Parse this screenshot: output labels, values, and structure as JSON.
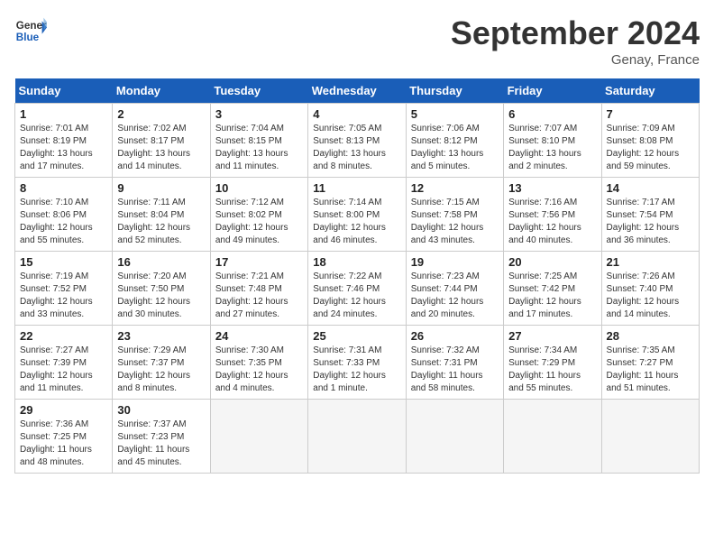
{
  "header": {
    "logo_line1": "General",
    "logo_line2": "Blue",
    "month": "September 2024",
    "location": "Genay, France"
  },
  "weekdays": [
    "Sunday",
    "Monday",
    "Tuesday",
    "Wednesday",
    "Thursday",
    "Friday",
    "Saturday"
  ],
  "weeks": [
    [
      {
        "day": "1",
        "info": "Sunrise: 7:01 AM\nSunset: 8:19 PM\nDaylight: 13 hours and 17 minutes."
      },
      {
        "day": "2",
        "info": "Sunrise: 7:02 AM\nSunset: 8:17 PM\nDaylight: 13 hours and 14 minutes."
      },
      {
        "day": "3",
        "info": "Sunrise: 7:04 AM\nSunset: 8:15 PM\nDaylight: 13 hours and 11 minutes."
      },
      {
        "day": "4",
        "info": "Sunrise: 7:05 AM\nSunset: 8:13 PM\nDaylight: 13 hours and 8 minutes."
      },
      {
        "day": "5",
        "info": "Sunrise: 7:06 AM\nSunset: 8:12 PM\nDaylight: 13 hours and 5 minutes."
      },
      {
        "day": "6",
        "info": "Sunrise: 7:07 AM\nSunset: 8:10 PM\nDaylight: 13 hours and 2 minutes."
      },
      {
        "day": "7",
        "info": "Sunrise: 7:09 AM\nSunset: 8:08 PM\nDaylight: 12 hours and 59 minutes."
      }
    ],
    [
      {
        "day": "8",
        "info": "Sunrise: 7:10 AM\nSunset: 8:06 PM\nDaylight: 12 hours and 55 minutes."
      },
      {
        "day": "9",
        "info": "Sunrise: 7:11 AM\nSunset: 8:04 PM\nDaylight: 12 hours and 52 minutes."
      },
      {
        "day": "10",
        "info": "Sunrise: 7:12 AM\nSunset: 8:02 PM\nDaylight: 12 hours and 49 minutes."
      },
      {
        "day": "11",
        "info": "Sunrise: 7:14 AM\nSunset: 8:00 PM\nDaylight: 12 hours and 46 minutes."
      },
      {
        "day": "12",
        "info": "Sunrise: 7:15 AM\nSunset: 7:58 PM\nDaylight: 12 hours and 43 minutes."
      },
      {
        "day": "13",
        "info": "Sunrise: 7:16 AM\nSunset: 7:56 PM\nDaylight: 12 hours and 40 minutes."
      },
      {
        "day": "14",
        "info": "Sunrise: 7:17 AM\nSunset: 7:54 PM\nDaylight: 12 hours and 36 minutes."
      }
    ],
    [
      {
        "day": "15",
        "info": "Sunrise: 7:19 AM\nSunset: 7:52 PM\nDaylight: 12 hours and 33 minutes."
      },
      {
        "day": "16",
        "info": "Sunrise: 7:20 AM\nSunset: 7:50 PM\nDaylight: 12 hours and 30 minutes."
      },
      {
        "day": "17",
        "info": "Sunrise: 7:21 AM\nSunset: 7:48 PM\nDaylight: 12 hours and 27 minutes."
      },
      {
        "day": "18",
        "info": "Sunrise: 7:22 AM\nSunset: 7:46 PM\nDaylight: 12 hours and 24 minutes."
      },
      {
        "day": "19",
        "info": "Sunrise: 7:23 AM\nSunset: 7:44 PM\nDaylight: 12 hours and 20 minutes."
      },
      {
        "day": "20",
        "info": "Sunrise: 7:25 AM\nSunset: 7:42 PM\nDaylight: 12 hours and 17 minutes."
      },
      {
        "day": "21",
        "info": "Sunrise: 7:26 AM\nSunset: 7:40 PM\nDaylight: 12 hours and 14 minutes."
      }
    ],
    [
      {
        "day": "22",
        "info": "Sunrise: 7:27 AM\nSunset: 7:39 PM\nDaylight: 12 hours and 11 minutes."
      },
      {
        "day": "23",
        "info": "Sunrise: 7:29 AM\nSunset: 7:37 PM\nDaylight: 12 hours and 8 minutes."
      },
      {
        "day": "24",
        "info": "Sunrise: 7:30 AM\nSunset: 7:35 PM\nDaylight: 12 hours and 4 minutes."
      },
      {
        "day": "25",
        "info": "Sunrise: 7:31 AM\nSunset: 7:33 PM\nDaylight: 12 hours and 1 minute."
      },
      {
        "day": "26",
        "info": "Sunrise: 7:32 AM\nSunset: 7:31 PM\nDaylight: 11 hours and 58 minutes."
      },
      {
        "day": "27",
        "info": "Sunrise: 7:34 AM\nSunset: 7:29 PM\nDaylight: 11 hours and 55 minutes."
      },
      {
        "day": "28",
        "info": "Sunrise: 7:35 AM\nSunset: 7:27 PM\nDaylight: 11 hours and 51 minutes."
      }
    ],
    [
      {
        "day": "29",
        "info": "Sunrise: 7:36 AM\nSunset: 7:25 PM\nDaylight: 11 hours and 48 minutes."
      },
      {
        "day": "30",
        "info": "Sunrise: 7:37 AM\nSunset: 7:23 PM\nDaylight: 11 hours and 45 minutes."
      },
      {
        "day": "",
        "info": ""
      },
      {
        "day": "",
        "info": ""
      },
      {
        "day": "",
        "info": ""
      },
      {
        "day": "",
        "info": ""
      },
      {
        "day": "",
        "info": ""
      }
    ]
  ]
}
